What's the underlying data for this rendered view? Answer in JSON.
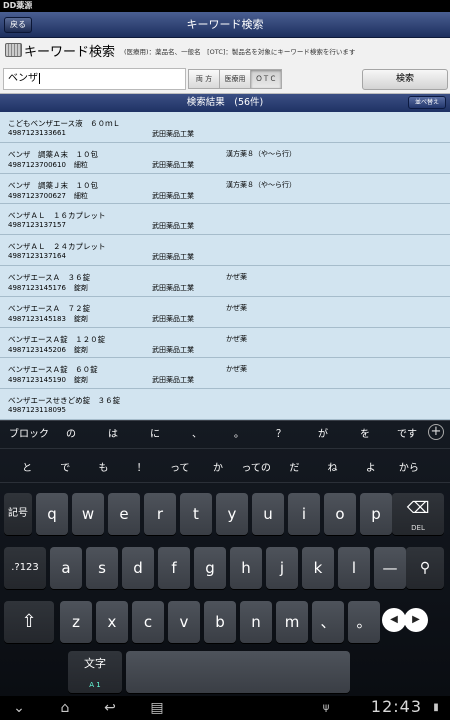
{
  "status_bar": {
    "app_name": "DD薬源"
  },
  "nav": {
    "back_label": "戻る",
    "title": "キーワード検索"
  },
  "search_panel": {
    "heading": "キーワード検索",
    "hint": "(医療用)：薬品名、一般名　[OTC]：製品名を対象にキーワード検索を行います",
    "input_value": "ベンザ",
    "segments": [
      {
        "label": "両 方",
        "active": false
      },
      {
        "label": "医療用",
        "active": false
      },
      {
        "label": "ＯＴＣ",
        "active": true
      }
    ],
    "search_button": "検索"
  },
  "results": {
    "title": "検索結果　(56件)",
    "sort_button": "並べ替え",
    "rows": [
      {
        "name": "こどもベンザエース液　６０ｍＬ",
        "code": "4987123133661",
        "form": "",
        "maker": "武田薬品工業",
        "category": ""
      },
      {
        "name": "ベンザ　調薬Ａ末　１０包",
        "code": "4987123700610",
        "form": "細粒",
        "maker": "武田薬品工業",
        "category": "漢方薬８（や～ら行）"
      },
      {
        "name": "ベンザ　調薬Ｊ末　１０包",
        "code": "4987123700627",
        "form": "細粒",
        "maker": "武田薬品工業",
        "category": "漢方薬８（や～ら行）"
      },
      {
        "name": "ベンザＡＬ　１６カプレット",
        "code": "4987123137157",
        "form": "",
        "maker": "武田薬品工業",
        "category": ""
      },
      {
        "name": "ベンザＡＬ　２４カプレット",
        "code": "4987123137164",
        "form": "",
        "maker": "武田薬品工業",
        "category": ""
      },
      {
        "name": "ベンザエースＡ　３６錠",
        "code": "4987123145176",
        "form": "錠剤",
        "maker": "武田薬品工業",
        "category": "かぜ薬"
      },
      {
        "name": "ベンザエースＡ　７２錠",
        "code": "4987123145183",
        "form": "錠剤",
        "maker": "武田薬品工業",
        "category": "かぜ薬"
      },
      {
        "name": "ベンザエースＡ錠　１２０錠",
        "code": "4987123145206",
        "form": "錠剤",
        "maker": "武田薬品工業",
        "category": "かぜ薬"
      },
      {
        "name": "ベンザエースＡ錠　６０錠",
        "code": "4987123145190",
        "form": "錠剤",
        "maker": "武田薬品工業",
        "category": "かぜ薬"
      },
      {
        "name": "ベンザエースせきどめ錠　３６錠",
        "code": "4987123118095",
        "form": "",
        "maker": "",
        "category": ""
      }
    ]
  },
  "keyboard": {
    "candidates_row1": [
      "ブロック",
      "の",
      "は",
      "に",
      "、",
      "。",
      "？",
      "が",
      "を",
      "です"
    ],
    "candidates_row2": [
      "と",
      "で",
      "も",
      "！",
      "って",
      "か",
      "っての",
      "だ",
      "ね",
      "よ",
      "から"
    ],
    "plus_icon": "+",
    "row_q": [
      "q",
      "w",
      "e",
      "r",
      "t",
      "y",
      "u",
      "i",
      "o",
      "p"
    ],
    "row_a": [
      "a",
      "s",
      "d",
      "f",
      "g",
      "h",
      "j",
      "k",
      "l",
      "—"
    ],
    "row_z": [
      "z",
      "x",
      "c",
      "v",
      "b",
      "n",
      "m",
      "、",
      "。"
    ],
    "symbol_key": "記号",
    "delete_label": "DEL",
    "num_key": ".?123",
    "mode_key": "文字",
    "mode_sub": "A 1"
  },
  "system_bar": {
    "clock": "12:43"
  }
}
